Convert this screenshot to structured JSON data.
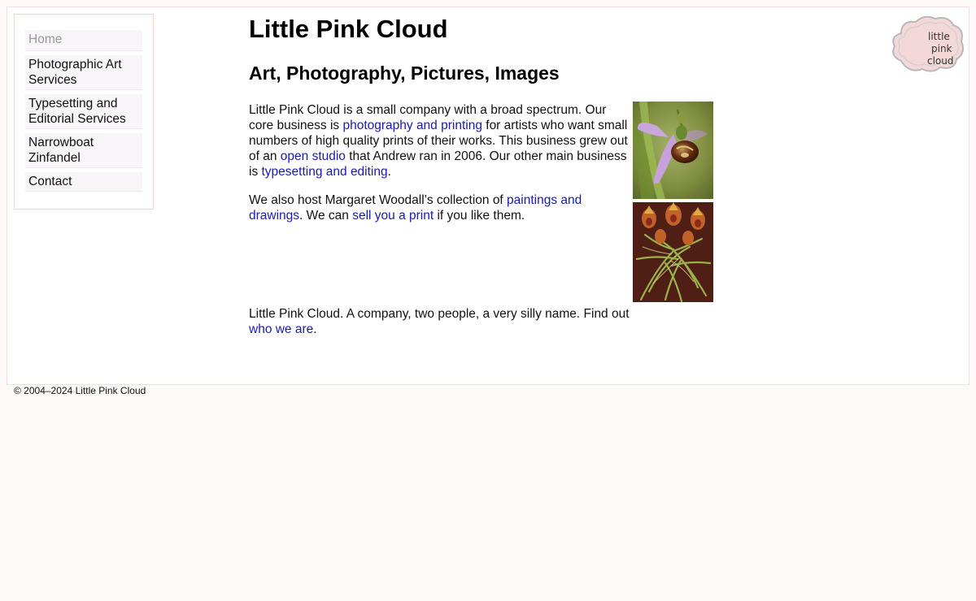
{
  "nav": {
    "items": [
      {
        "label": "Home",
        "current": true
      },
      {
        "label": "Photographic Art Services",
        "current": false
      },
      {
        "label": "Typesetting and Editorial Services",
        "current": false
      },
      {
        "label": "Narrowboat Zinfandel",
        "current": false
      },
      {
        "label": "Contact",
        "current": false
      }
    ]
  },
  "logo": {
    "line1": "little",
    "line2": "pink",
    "line3": "cloud"
  },
  "main": {
    "title": "Little Pink Cloud",
    "subtitle": "Art, Photography, Pictures, Images",
    "p1": {
      "t1": "Little Pink Cloud is a small company with a broad spectrum. Our core business is ",
      "l1": "photography and printing",
      "t2": " for artists who want small numbers of high quality prints of their works. This business grew out of an ",
      "l2": "open studio",
      "t3": " that Andrew ran in 2006. Our other main business is ",
      "l3": "typesetting and editing",
      "t4": "."
    },
    "p2": {
      "t1": "We also host Margaret Woodall’s collection of ",
      "l1": "paintings and drawings",
      "t2": ". We can ",
      "l2": "sell you a print",
      "t3": " if you like them."
    },
    "p3": {
      "t1": "Little Pink Cloud. A company, two people, a very silly name. Find out ",
      "l1": "who we are",
      "t2": "."
    }
  },
  "images": {
    "orchid": "bee-orchid-photo",
    "flowers": "fritillary-painting"
  },
  "footer": {
    "copyright": "© 2004–2024 Little Pink Cloud"
  },
  "colors": {
    "link": "#1a1ab0",
    "page_bg": "#fdf9f8",
    "border": "#f6d2d2"
  }
}
